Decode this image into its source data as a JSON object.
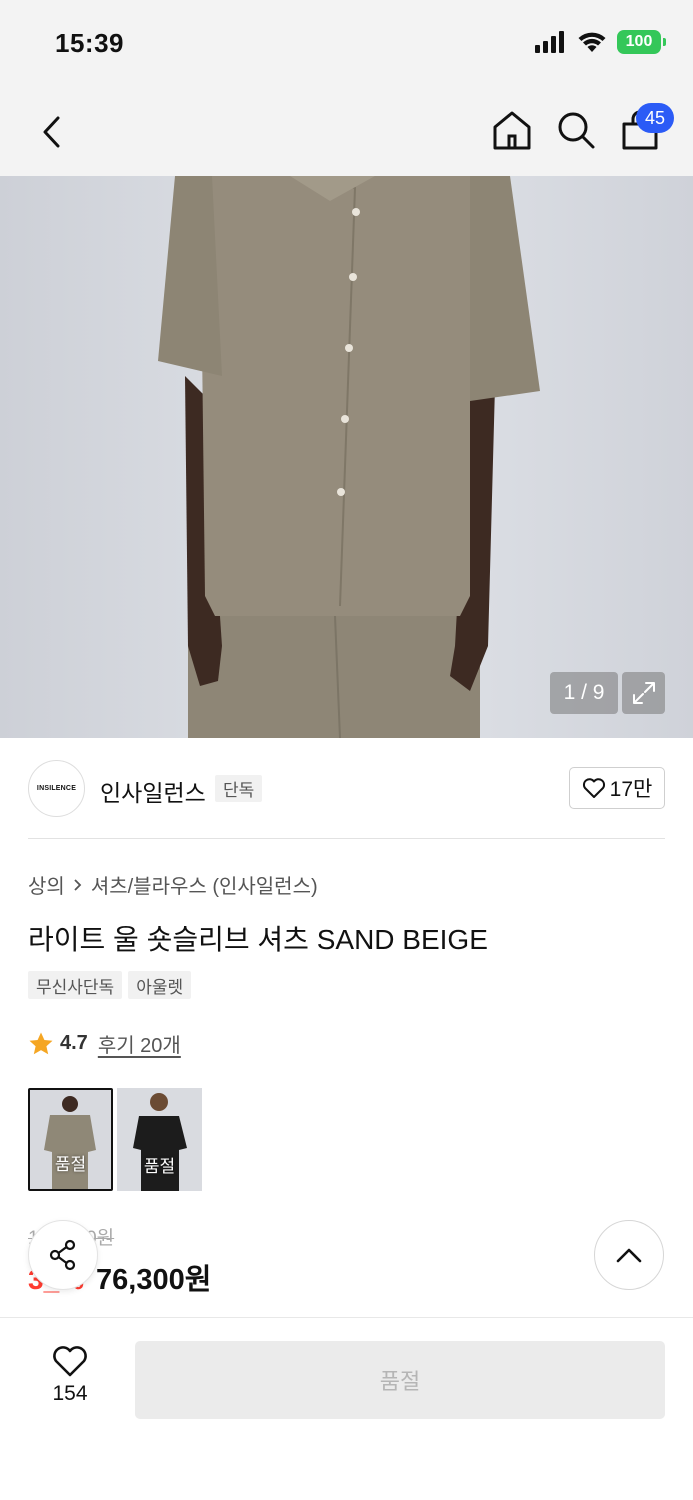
{
  "status_bar": {
    "time": "15:39",
    "battery": "100"
  },
  "nav": {
    "cart_count": "45",
    "icons": [
      "back-icon",
      "home-icon",
      "search-icon",
      "cart-icon"
    ]
  },
  "gallery": {
    "counter": "1 / 9",
    "expand_icon": "expand-icon"
  },
  "brand": {
    "logo_text": "INSILENCE",
    "name": "인사일런스",
    "tag": "단독",
    "like_count": "17만"
  },
  "product": {
    "breadcrumb": [
      "상의",
      "셔츠/블라우스 (인사일런스)"
    ],
    "title": "라이트 울 숏슬리브 셔츠 SAND BEIGE",
    "tags": [
      "무신사단독",
      "아울렛"
    ],
    "rating": "4.7",
    "reviews": "후기 20개",
    "colors": [
      {
        "label": "품절",
        "selected": true,
        "swatch": "#8f8877"
      },
      {
        "label": "품절",
        "selected": false,
        "swatch": "#1c1c1c"
      }
    ],
    "original_price": "1__,_00원",
    "discount": "3_%",
    "sale_price": "76,300원"
  },
  "bottom_bar": {
    "wish_count": "154",
    "buy_label": "품절"
  },
  "colors": {
    "accent": "#2b5bf6",
    "discount": "#ff3b30",
    "star": "#f5a623"
  }
}
